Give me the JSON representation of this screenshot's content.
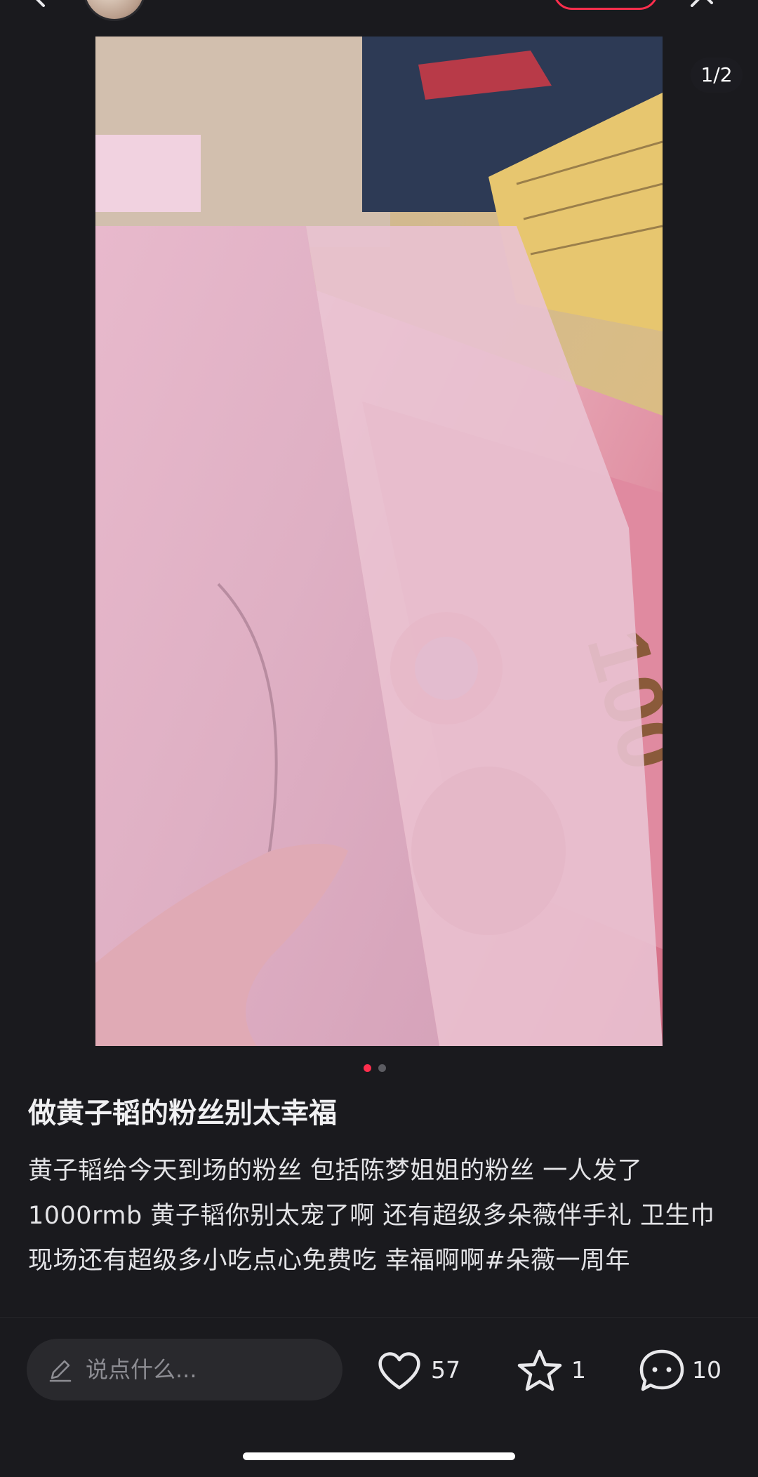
{
  "header": {
    "back_icon": "back-arrow-icon",
    "share_icon": "share-icon"
  },
  "photo": {
    "page_indicator": "1/2",
    "current_page": 1,
    "total_pages": 2
  },
  "post": {
    "title": "做黄子韬的粉丝别太幸福",
    "body": "黄子韬给今天到场的粉丝 包括陈梦姐姐的粉丝 一人发了1000rmb 黄子韬你别太宠了啊 还有超级多朵薇伴手礼 卫生巾 现场还有超级多小吃点心免费吃 幸福啊啊#朵薇一周年"
  },
  "bottom_bar": {
    "comment_placeholder": "说点什么...",
    "likes": "57",
    "favorites": "1",
    "comments": "10"
  },
  "colors": {
    "background": "#1a1a1e",
    "accent": "#ff2e4d",
    "input_bg": "#29292d"
  }
}
